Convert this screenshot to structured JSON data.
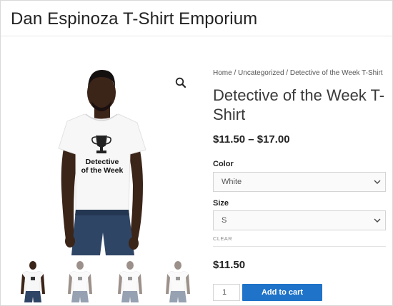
{
  "site": {
    "title": "Dan Espinoza T-Shirt Emporium"
  },
  "breadcrumb": {
    "home": "Home",
    "sep1": " / ",
    "category": "Uncategorized",
    "sep2": " / ",
    "current": "Detective of the Week T-Shirt"
  },
  "product": {
    "title": "Detective of the Week T-Shirt",
    "price_range": "$11.50 – $17.00",
    "shirt_text_line1": "Detective",
    "shirt_text_line2": "of the Week"
  },
  "variations": {
    "color_label": "Color",
    "color_value": "White",
    "size_label": "Size",
    "size_value": "S",
    "clear_label": "CLEAR"
  },
  "cart": {
    "variation_price": "$11.50",
    "quantity": "1",
    "add_label": "Add to cart"
  },
  "colors": {
    "accent": "#1f73c9",
    "shirt": "#f7f7f7",
    "skin": "#3b2418",
    "jeans": "#2f4566"
  },
  "icons": {
    "zoom": "magnifier-icon",
    "select": "chevron-down-icon"
  }
}
